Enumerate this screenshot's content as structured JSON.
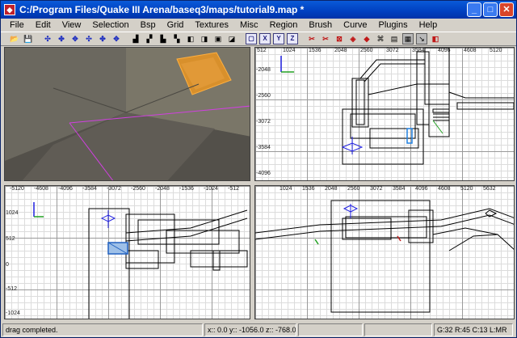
{
  "window": {
    "title": "C:/Program Files/Quake III Arena/baseq3/maps/tutorial9.map *"
  },
  "icons": {
    "app": "radiant-app-icon",
    "minimize": "minimize-icon",
    "maximize": "maximize-icon",
    "close": "close-icon"
  },
  "menu": [
    "File",
    "Edit",
    "View",
    "Selection",
    "Bsp",
    "Grid",
    "Textures",
    "Misc",
    "Region",
    "Brush",
    "Curve",
    "Plugins",
    "Help"
  ],
  "views": {
    "top_right": {
      "ruler_top": [
        "512",
        "1024",
        "1536",
        "2048",
        "2560",
        "3072",
        "3584",
        "4096",
        "4608",
        "5120"
      ],
      "ruler_left": [
        "-2048",
        "-2560",
        "-3072",
        "-3584",
        "-4096"
      ]
    },
    "bottom_left": {
      "ruler_top": [
        "-5120",
        "-4608",
        "-4096",
        "-3584",
        "-3072",
        "-2560",
        "-2048",
        "-1536",
        "-1024",
        "-512"
      ],
      "ruler_left": [
        "1024",
        "512",
        "0",
        "-512",
        "-1024"
      ]
    },
    "bottom_right": {
      "ruler_top": [
        "1024",
        "1536",
        "2048",
        "2560",
        "3072",
        "3584",
        "4096",
        "4608",
        "5120",
        "5632"
      ]
    }
  },
  "status": {
    "message": "drag completed.",
    "coords": "x:: 0.0  y:: -1056.0  z:: -768.0",
    "grid": "G:32 R:45 C:13 L:MR"
  }
}
